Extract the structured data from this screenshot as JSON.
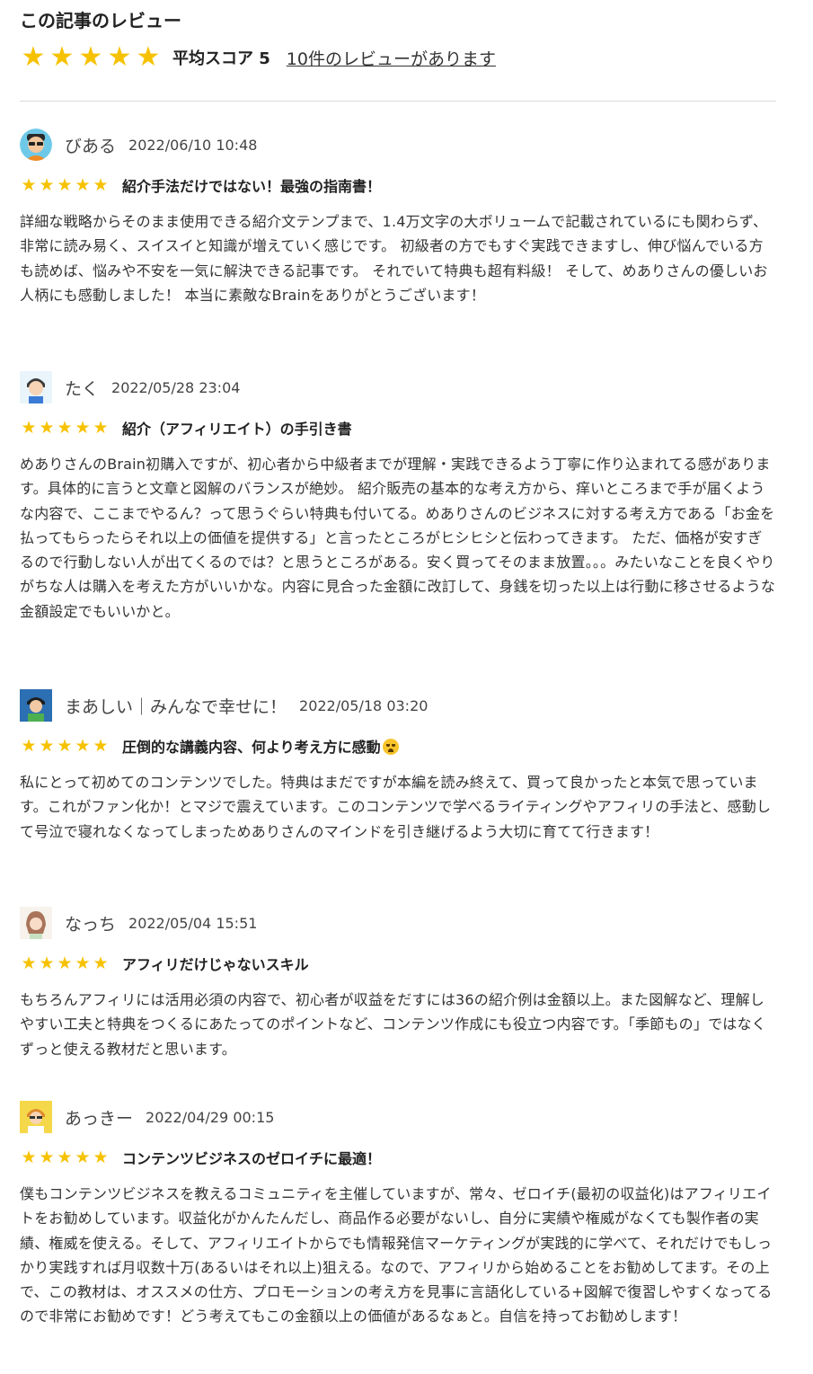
{
  "header": {
    "title": "この記事のレビュー",
    "average_label": "平均スコア 5",
    "count_link": "10件のレビューがあります",
    "star_color": "#f6c200",
    "rating": 5
  },
  "reviews": [
    {
      "user": "びある",
      "date": "2022/06/10 10:48",
      "rating": 5,
      "title": "紹介手法だけではない！最強の指南書！",
      "body": "詳細な戦略からそのまま使用できる紹介文テンプまで、1.4万文字の大ボリュームで記載されているにも関わらず、非常に読み易く、スイスイと知識が増えていく感じです。 初級者の方でもすぐ実践できますし、伸び悩んでいる方も読めば、悩みや不安を一気に解決できる記事です。 それでいて特典も超有料級！ そして、めありさんの優しいお人柄にも感動しました！ 本当に素敵なBrainをありがとうございます！"
    },
    {
      "user": "たく",
      "date": "2022/05/28 23:04",
      "rating": 5,
      "title": "紹介（アフィリエイト）の手引き書",
      "body": "めありさんのBrain初購入ですが、初心者から中級者までが理解・実践できるよう丁寧に作り込まれてる感があります。具体的に言うと文章と図解のバランスが絶妙。 紹介販売の基本的な考え方から、痒いところまで手が届くような内容で、ここまでやるん？って思うぐらい特典も付いてる。めありさんのビジネスに対する考え方である「お金を払ってもらったらそれ以上の価値を提供する」と言ったところがヒシヒシと伝わってきます。 ただ、価格が安すぎるので行動しない人が出てくるのでは？と思うところがある。安く買ってそのまま放置。。。みたいなことを良くやりがちな人は購入を考えた方がいいかな。内容に見合った金額に改訂して、身銭を切った以上は行動に移させるような金額設定でもいいかと。"
    },
    {
      "user": "まあしい｜みんなで幸せに！",
      "date": "2022/05/18 03:20",
      "rating": 5,
      "title": "圧倒的な講義内容、何より考え方に感動",
      "body": "私にとって初めてのコンテンツでした。特典はまだですが本編を読み終えて、買って良かったと本気で思っています。これがファン化か！とマジで震えています。このコンテンツで学べるライティングやアフィリの手法と、感動して号泣で寝れなくなってしまっためありさんのマインドを引き継げるよう大切に育てて行きます！"
    },
    {
      "user": "なっち",
      "date": "2022/05/04 15:51",
      "rating": 5,
      "title": "アフィリだけじゃないスキル",
      "body": "もちろんアフィリには活用必須の内容で、初心者が収益をだすには36の紹介例は金額以上。また図解など、理解しやすい工夫と特典をつくるにあたってのポイントなど、コンテンツ作成にも役立つ内容です。「季節もの」ではなくずっと使える教材だと思います。"
    },
    {
      "user": "あっきー",
      "date": "2022/04/29 00:15",
      "rating": 5,
      "title": "コンテンツビジネスのゼロイチに最適！",
      "body": "僕もコンテンツビジネスを教えるコミュニティを主催していますが、常々、ゼロイチ(最初の収益化)はアフィリエイトをお勧めしています。収益化がかんたんだし、商品作る必要がないし、自分に実績や権威がなくても製作者の実績、権威を使える。そして、アフィリエイトからでも情報発信マーケティングが実践的に学べて、それだけでもしっかり実践すれば月収数十万(あるいはそれ以上)狙える。なので、アフィリから始めることをお勧めしてます。その上で、この教材は、オススメの仕方、プロモーションの考え方を見事に言語化している+図解で復習しやすくなってるので非常にお勧めです！どう考えてもこの金額以上の価値があるなぁと。自信を持ってお勧めします！"
    }
  ]
}
